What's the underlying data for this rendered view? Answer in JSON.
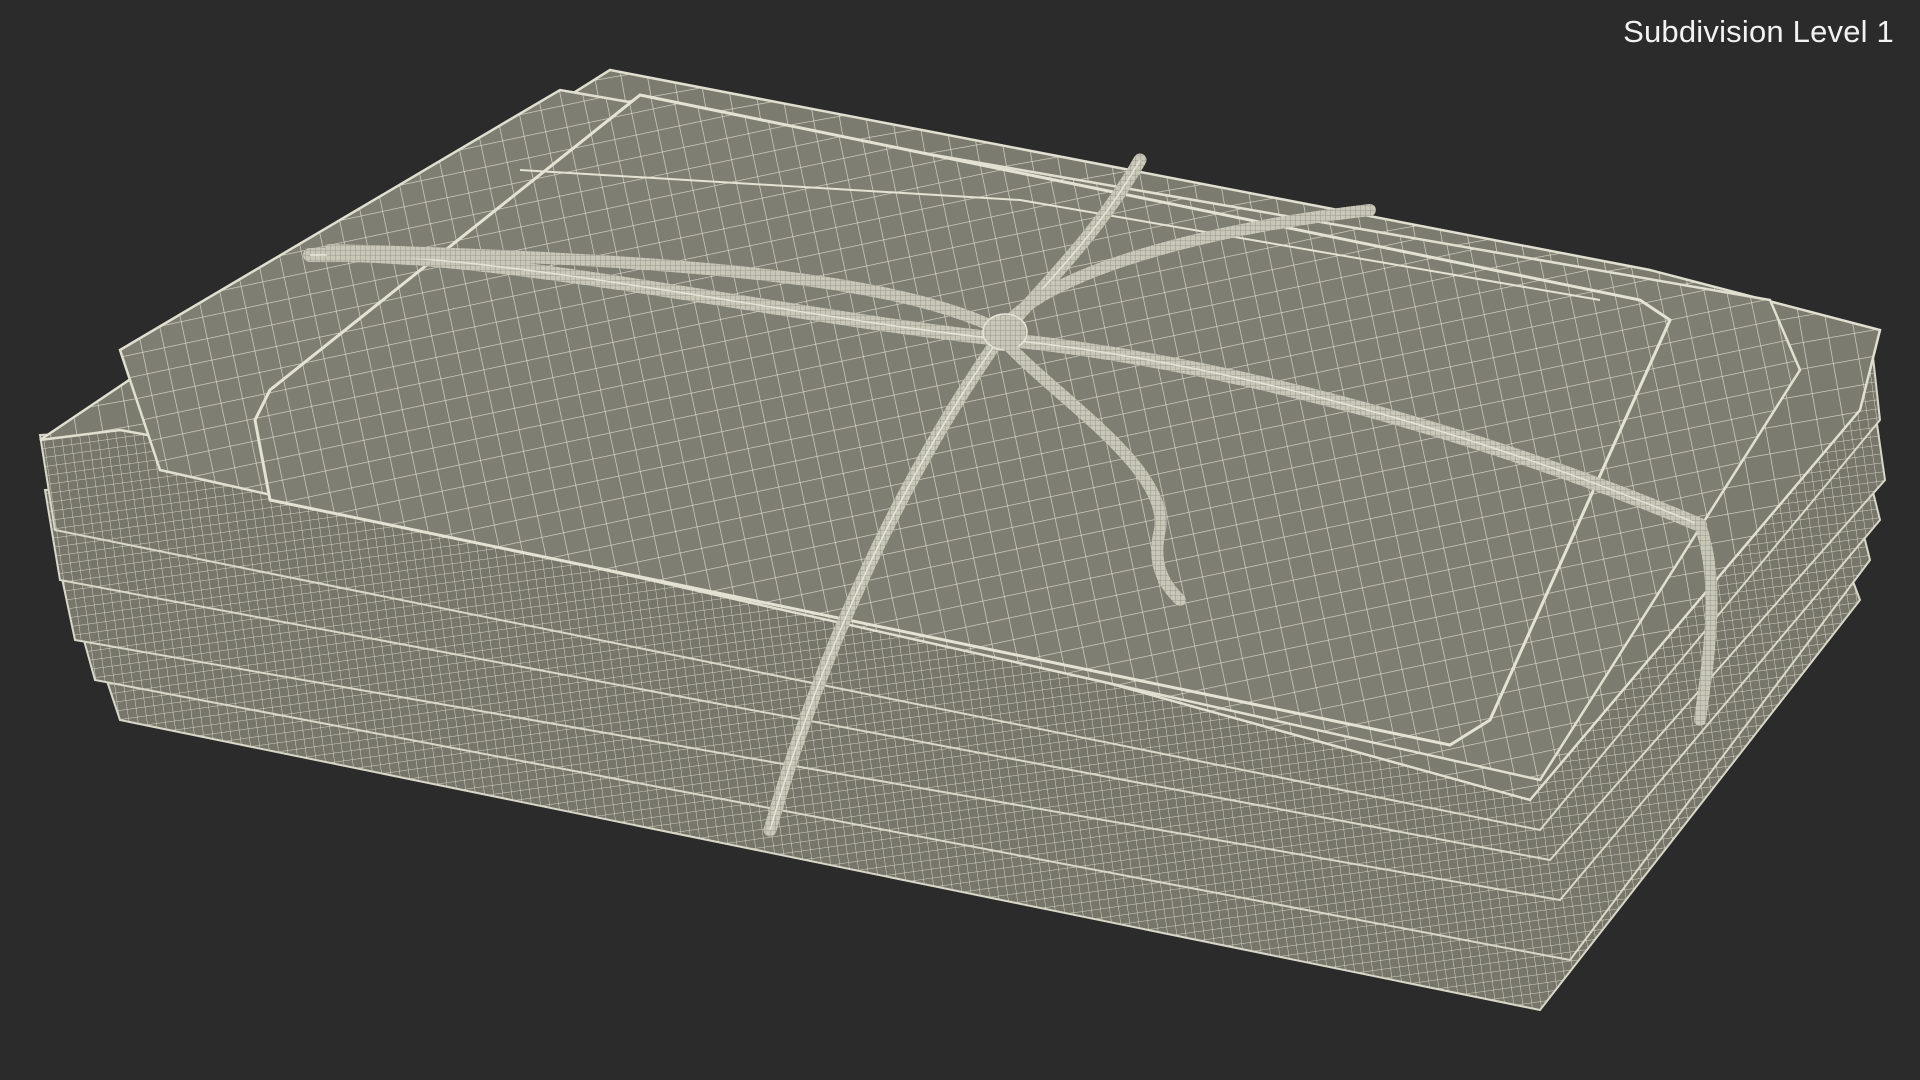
{
  "viewport": {
    "label": "Subdivision Level 1",
    "background_color": "#2b2b2b"
  },
  "model": {
    "name": "stack-of-envelopes-tied-with-string",
    "surface_color": "#7d7d72",
    "wire_color": "#d9d7c8",
    "display_mode": "wireframe-on-shaded"
  }
}
